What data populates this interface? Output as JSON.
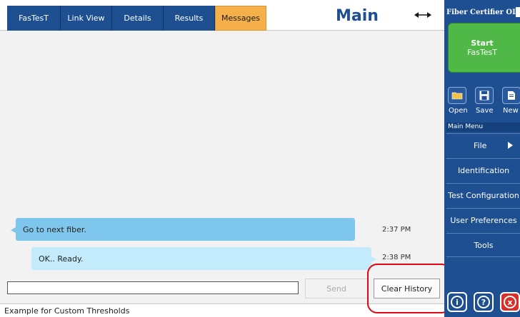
{
  "tabs": [
    {
      "label": "FasTesT",
      "active": false
    },
    {
      "label": "Link View",
      "active": false
    },
    {
      "label": "Details",
      "active": false
    },
    {
      "label": "Results",
      "active": false
    },
    {
      "label": "Messages",
      "active": true
    }
  ],
  "header": {
    "view_title": "Main",
    "expand_icon": "double-arrow-icon"
  },
  "messages": [
    {
      "text": "Go to next fiber.",
      "time": "2:37 PM",
      "direction": "incoming"
    },
    {
      "text": "OK.. Ready.",
      "time": "2:38 PM",
      "direction": "outgoing"
    }
  ],
  "composer": {
    "input_value": "",
    "send_label": "Send",
    "clear_label": "Clear History"
  },
  "status_bar": {
    "text": "Example for Custom Thresholds"
  },
  "side_panel": {
    "app_title": "Fiber Certifier OLTS",
    "start_button": {
      "label": "Start",
      "sublabel": "FasTesT"
    },
    "tools": [
      {
        "label": "Open",
        "icon": "folder-icon"
      },
      {
        "label": "Save",
        "icon": "floppy-disk-icon"
      },
      {
        "label": "New",
        "icon": "new-document-icon"
      }
    ],
    "menu_header": "Main Menu",
    "menu_items": [
      "File",
      "Identification",
      "Test Configuration",
      "User Preferences",
      "Tools"
    ],
    "bottom_buttons": [
      {
        "icon": "info-icon",
        "glyph": "i"
      },
      {
        "icon": "help-icon",
        "glyph": "?"
      },
      {
        "icon": "close-icon",
        "glyph": "x"
      }
    ]
  },
  "colors": {
    "tab_blue": "#1d4f91",
    "tab_active": "#f5b04a",
    "start_green": "#4fb847",
    "bubble_incoming": "#7fc6ec",
    "bubble_outgoing": "#c4ebfb",
    "highlight_red": "#e30613"
  }
}
